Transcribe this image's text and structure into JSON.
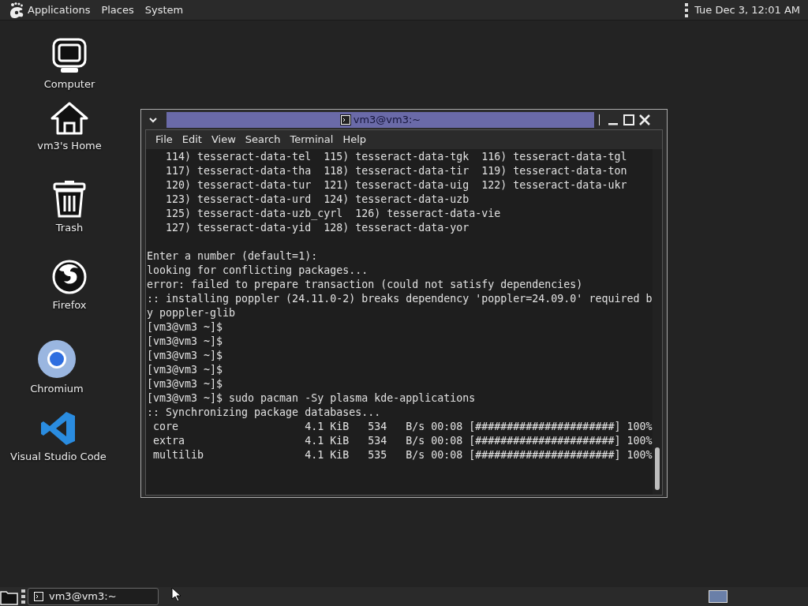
{
  "top_panel": {
    "menus": [
      "Applications",
      "Places",
      "System"
    ],
    "clock": "Tue Dec 3, 12:01 AM"
  },
  "desktop_icons": [
    {
      "kind": "computer",
      "label": "Computer"
    },
    {
      "kind": "home",
      "label": "vm3's Home"
    },
    {
      "kind": "trash",
      "label": "Trash"
    },
    {
      "kind": "firefox",
      "label": "Firefox"
    },
    {
      "kind": "chromium",
      "label": "Chromium"
    },
    {
      "kind": "vscode",
      "label": "Visual Studio Code"
    }
  ],
  "terminal": {
    "title": "vm3@vm3:~",
    "menu": [
      "File",
      "Edit",
      "View",
      "Search",
      "Terminal",
      "Help"
    ],
    "blocks": [
      [
        "   114) tesseract-data-tel  115) tesseract-data-tgk  116) tesseract-data-tgl",
        "   117) tesseract-data-tha  118) tesseract-data-tir  119) tesseract-data-ton",
        "   120) tesseract-data-tur  121) tesseract-data-uig  122) tesseract-data-ukr",
        "   123) tesseract-data-urd  124) tesseract-data-uzb",
        "   125) tesseract-data-uzb_cyrl  126) tesseract-data-vie",
        "   127) tesseract-data-yid  128) tesseract-data-yor"
      ],
      [
        "Enter a number (default=1):",
        "looking for conflicting packages...",
        "error: failed to prepare transaction (could not satisfy dependencies)",
        ":: installing poppler (24.11.0-2) breaks dependency 'poppler=24.09.0' required b",
        "y poppler-glib",
        "[vm3@vm3 ~]$",
        "[vm3@vm3 ~]$",
        "[vm3@vm3 ~]$",
        "[vm3@vm3 ~]$",
        "[vm3@vm3 ~]$",
        "[vm3@vm3 ~]$ sudo pacman -Sy plasma kde-applications",
        ":: Synchronizing package databases...",
        " core                    4.1 KiB   534   B/s 00:08 [######################] 100%",
        " extra                   4.1 KiB   534   B/s 00:08 [######################] 100%",
        " multilib                4.1 KiB   535   B/s 00:08 [######################] 100%"
      ]
    ]
  },
  "taskbar": {
    "tasks": [
      {
        "label": "vm3@vm3:~"
      }
    ]
  }
}
